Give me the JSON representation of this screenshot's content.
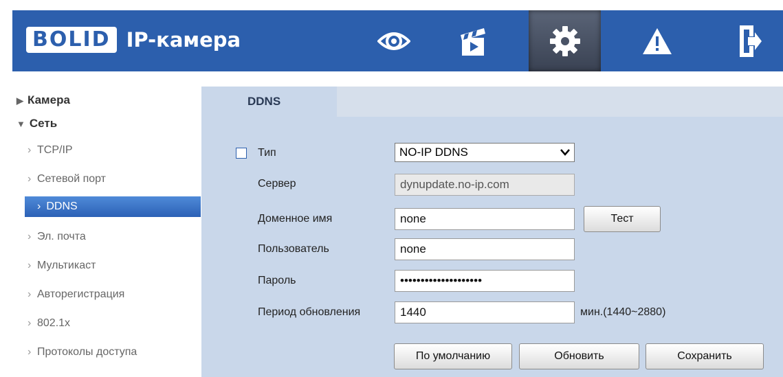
{
  "header": {
    "logo_text": "BOLID",
    "title": "IP-камера",
    "bg_color": "#2c5fad",
    "nav_icons": [
      "eye-icon",
      "clapperboard-icon",
      "gear-icon",
      "warning-icon",
      "exit-door-icon"
    ],
    "active_icon": "gear-icon"
  },
  "sidebar": {
    "categories": [
      {
        "label": "Камера",
        "expanded": false
      },
      {
        "label": "Сеть",
        "expanded": true
      }
    ],
    "items": [
      "TCP/IP",
      "Сетевой порт",
      "DDNS",
      "Эл. почта",
      "Мультикаст",
      "Авторегистрация",
      "802.1x",
      "Протоколы доступа"
    ],
    "active_item": "DDNS"
  },
  "tab": {
    "label": "DDNS"
  },
  "form": {
    "type_label": "Тип",
    "type_value": "NO-IP DDNS",
    "server_label": "Сервер",
    "server_value": "dynupdate.no-ip.com",
    "domain_label": "Доменное имя",
    "domain_value": "none",
    "user_label": "Пользователь",
    "user_value": "none",
    "password_label": "Пароль",
    "password_value": "••••••••••••••••••••",
    "period_label": "Период обновления",
    "period_value": "1440",
    "period_hint": "мин.(1440~2880)",
    "enabled": false
  },
  "buttons": {
    "test": "Тест",
    "default": "По умолчанию",
    "refresh": "Обновить",
    "save": "Сохранить"
  }
}
